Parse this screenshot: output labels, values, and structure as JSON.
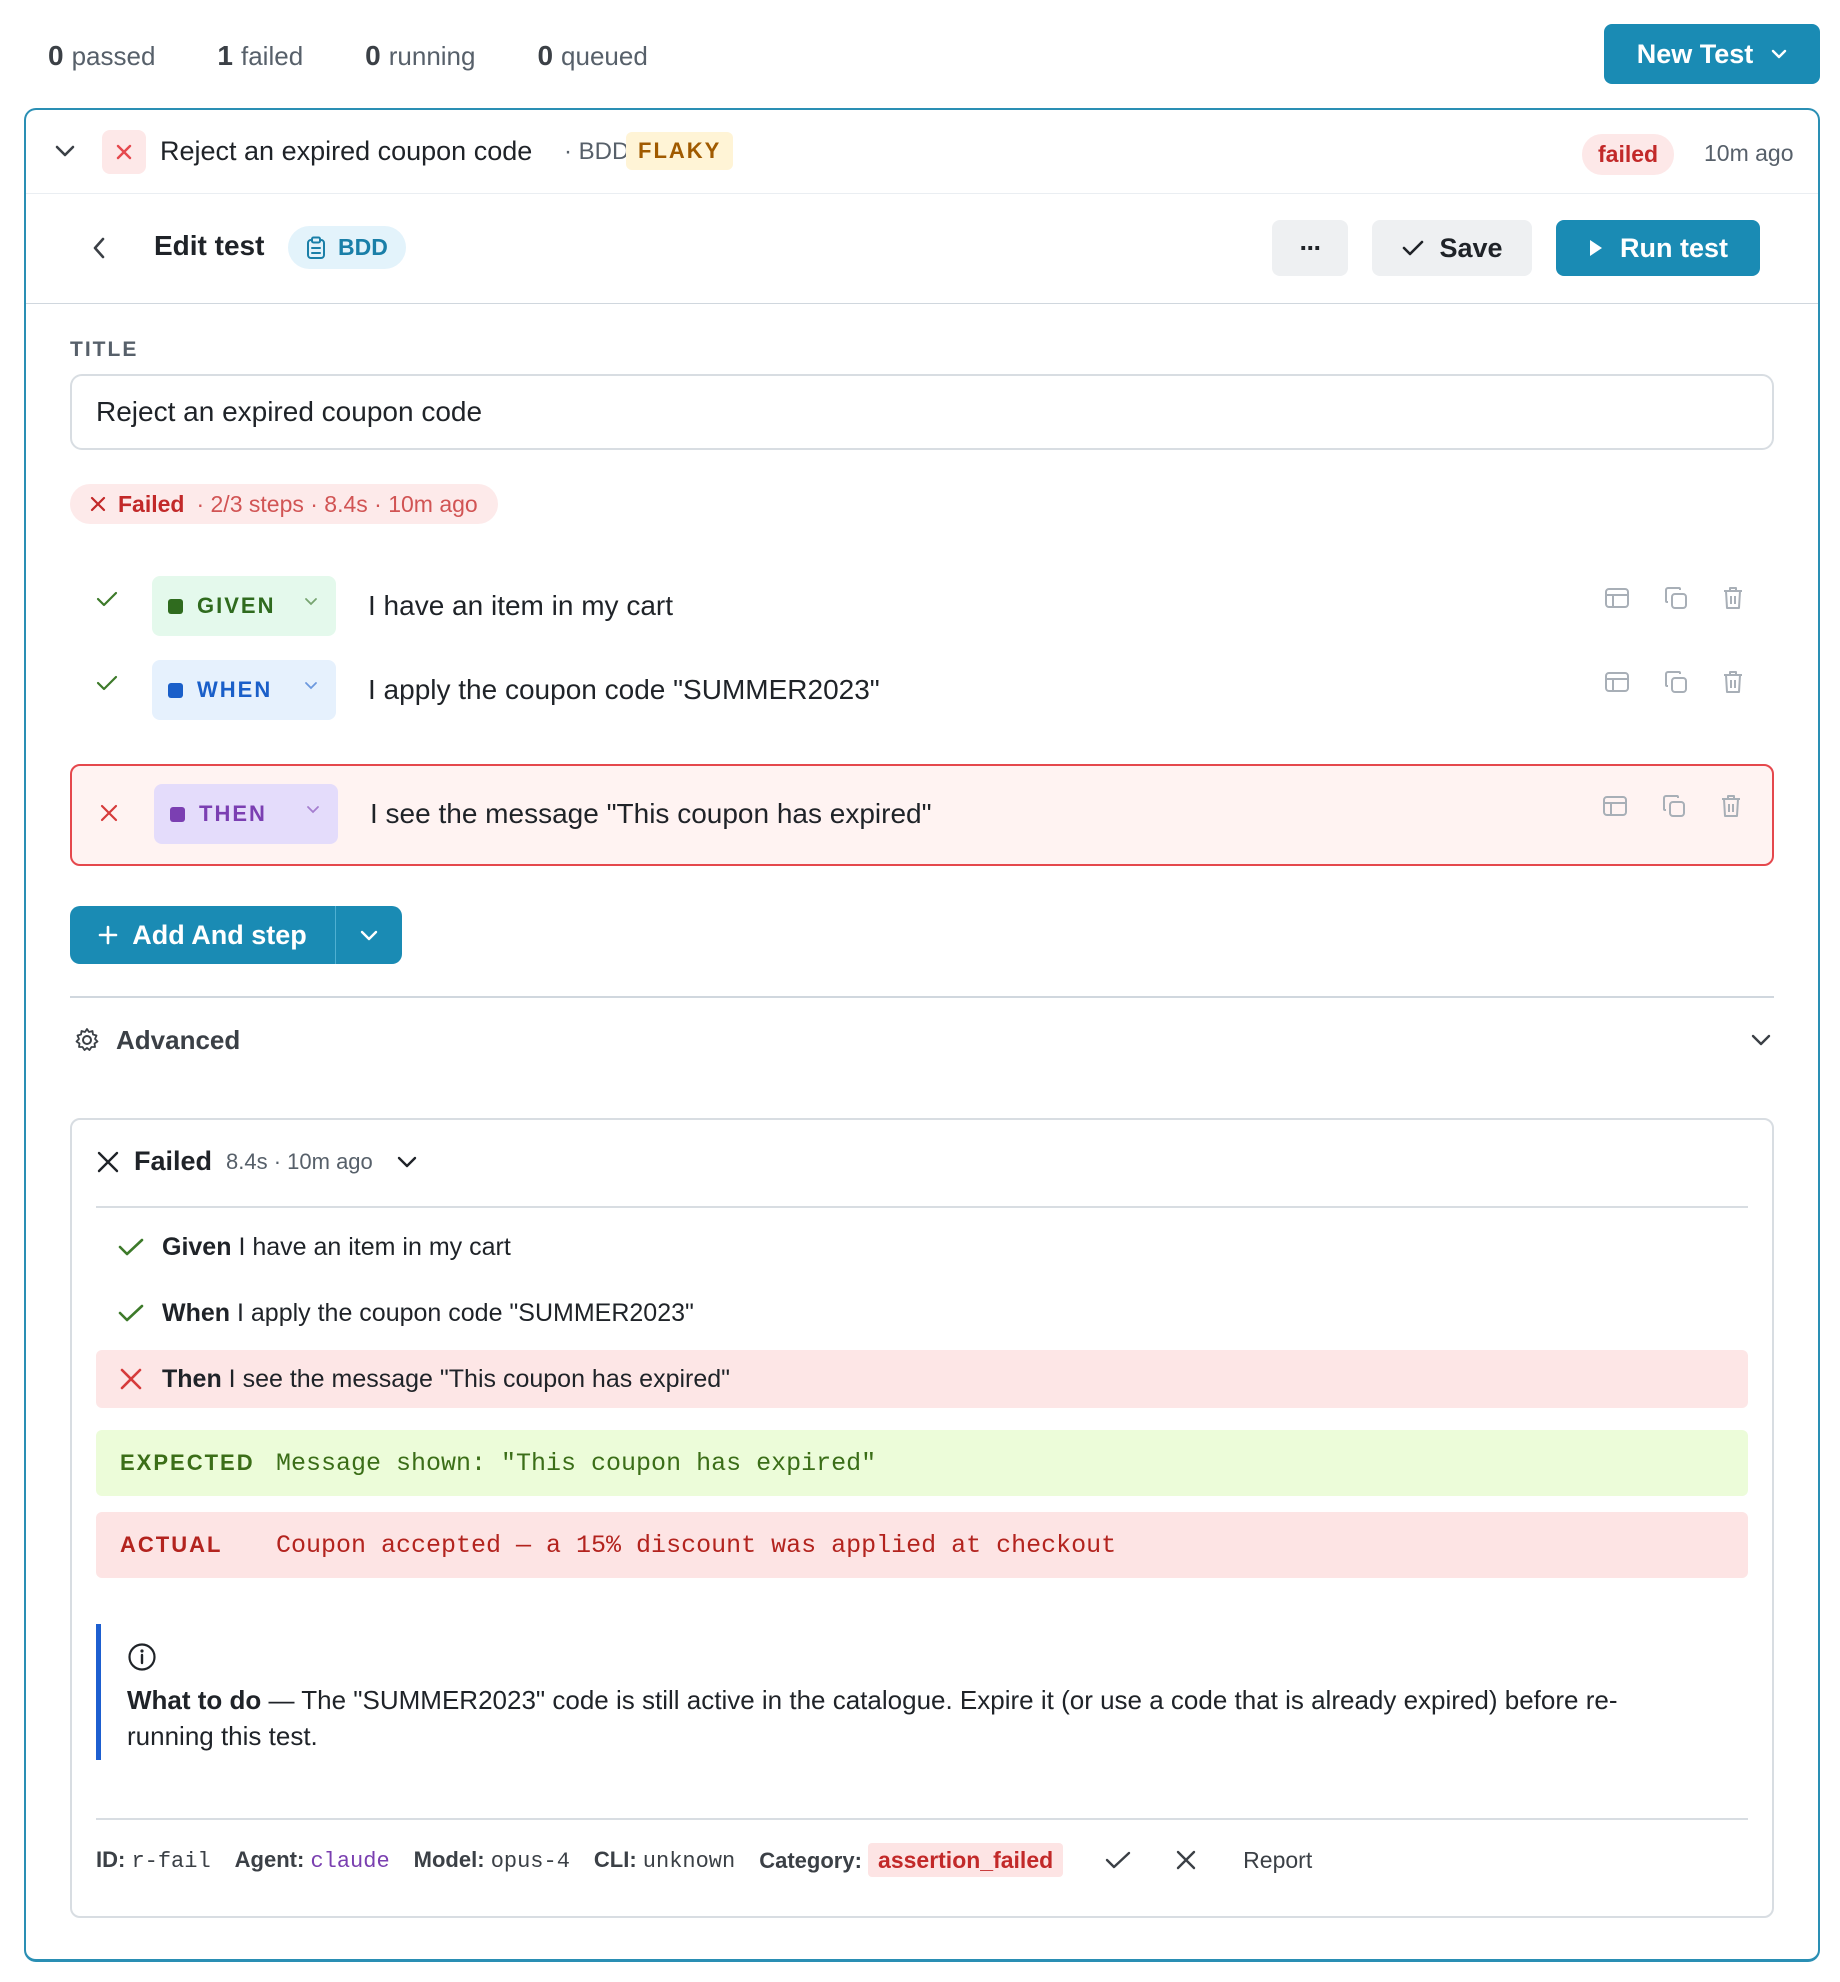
{
  "summary": {
    "passed_count": "0",
    "passed_label": "passed",
    "failed_count": "1",
    "failed_label": "failed",
    "running_count": "0",
    "running_label": "running",
    "queued_count": "0",
    "queued_label": "queued"
  },
  "new_test_label": "New Test",
  "test_header": {
    "title": "Reject an expired coupon code",
    "kind": "· BDD",
    "flaky_badge": "FLAKY",
    "status": "failed",
    "time_ago": "10m ago"
  },
  "toolbar": {
    "title": "Edit test",
    "type_badge": "BDD",
    "more_label": "···",
    "save_label": "Save",
    "run_label": "Run test"
  },
  "form": {
    "title_label": "TITLE",
    "title_value": "Reject an expired coupon code"
  },
  "status_line": {
    "label": "Failed",
    "detail": "· 2/3 steps · 8.4s · 10m ago"
  },
  "steps": [
    {
      "state": "passed",
      "keyword": "GIVEN",
      "text": "I have an item in my cart",
      "color": "#2f6b1e",
      "bg": "#e4f9ec"
    },
    {
      "state": "passed",
      "keyword": "WHEN",
      "text": "I apply the coupon code \"SUMMER2023\"",
      "color": "#1a5fc9",
      "bg": "#e6f1fd"
    },
    {
      "state": "failed",
      "keyword": "THEN",
      "text": "I see the message \"This coupon has expired\"",
      "color": "#7b3fb2",
      "bg": "#e4dcfb"
    }
  ],
  "add_step_label": "Add And step",
  "advanced_label": "Advanced",
  "result": {
    "label": "Failed",
    "meta": "8.4s · 10m ago",
    "steps": [
      {
        "state": "passed",
        "keyword": "Given",
        "text": "I have an item in my cart"
      },
      {
        "state": "passed",
        "keyword": "When",
        "text": "I apply the coupon code \"SUMMER2023\""
      },
      {
        "state": "failed",
        "keyword": "Then",
        "text": "I see the message \"This coupon has expired\""
      }
    ],
    "expected_label": "EXPECTED",
    "expected_text": "Message shown: \"This coupon has expired\"",
    "actual_label": "ACTUAL",
    "actual_text": "Coupon accepted — a 15% discount was applied at checkout",
    "todo_title": "What to do",
    "todo_text": " — The \"SUMMER2023\" code is still active in the catalogue. Expire it (or use a code that is already expired) before re-running this test.",
    "footer": {
      "id_label": "ID:",
      "id_value": "r-fail",
      "agent_label": "Agent:",
      "agent_value": "claude",
      "model_label": "Model:",
      "model_value": "opus-4",
      "cli_label": "CLI:",
      "cli_value": "unknown",
      "category_label": "Category:",
      "category_value": "assertion_failed",
      "report_label": "Report"
    }
  },
  "colors": {
    "accent": "#1a8bb4",
    "fail": "#c22929",
    "pass": "#2f6b1e"
  }
}
